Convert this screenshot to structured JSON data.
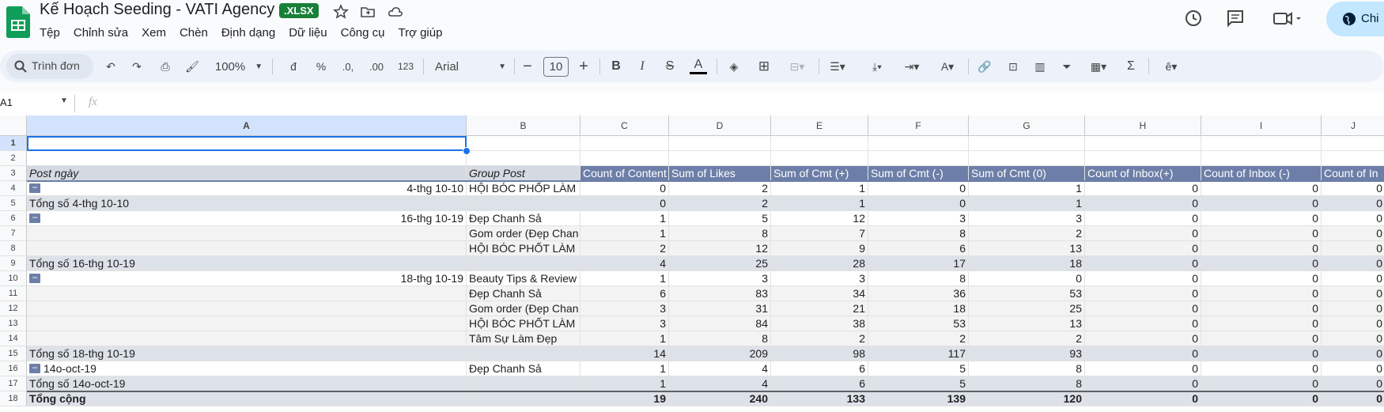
{
  "doc": {
    "title": "Kế Hoạch Seeding - VATI Agency",
    "badge": ".XLSX",
    "share_label": "Chi"
  },
  "menu": [
    "Tệp",
    "Chỉnh sửa",
    "Xem",
    "Chèn",
    "Định dạng",
    "Dữ liệu",
    "Công cụ",
    "Trợ giúp"
  ],
  "toolbar": {
    "search": "Trình đơn",
    "zoom": "100%",
    "currency": "đ",
    "percent": "%",
    "dec_decrease": ".0,",
    "dec_increase": ".00",
    "format_123": "123",
    "font": "Arial",
    "font_size": "10",
    "bold": "B",
    "italic": "I",
    "strike": "S",
    "textcolor": "A",
    "sigma": "Σ"
  },
  "formula_bar": {
    "cell_ref": "A1",
    "fx": "fx",
    "value": ""
  },
  "columns": [
    "A",
    "B",
    "C",
    "D",
    "E",
    "F",
    "G",
    "H",
    "I",
    "J"
  ],
  "header_row": {
    "a": "Post ngày",
    "b": "Group Post",
    "c": "Count of Content",
    "d": "Sum of Likes",
    "e": "Sum of Cmt (+)",
    "f": "Sum of Cmt (-)",
    "g": "Sum of Cmt (0)",
    "h": "Count of Inbox(+)",
    "i": "Count of Inbox (-)",
    "j": "Count of In"
  },
  "rows": [
    {
      "n": "1",
      "a": "",
      "b": "",
      "v": [
        "",
        "",
        "",
        "",
        "",
        "",
        "",
        ""
      ]
    },
    {
      "n": "2",
      "a": "",
      "b": "",
      "v": [
        "",
        "",
        "",
        "",
        "",
        "",
        "",
        ""
      ]
    },
    {
      "n": "4",
      "a": "4-thg 10-10",
      "b": "HỘI BÓC PHỐP LÀM",
      "v": [
        "0",
        "2",
        "1",
        "0",
        "1",
        "0",
        "0",
        "0"
      ]
    },
    {
      "n": "5",
      "a": "Tổng số 4-thg 10-10",
      "b": "",
      "v": [
        "0",
        "2",
        "1",
        "0",
        "1",
        "0",
        "0",
        "0"
      ]
    },
    {
      "n": "6",
      "a": "16-thg 10-19",
      "b": "Đẹp Chanh Sả",
      "v": [
        "1",
        "5",
        "12",
        "3",
        "3",
        "0",
        "0",
        "0"
      ]
    },
    {
      "n": "7",
      "a": "",
      "b": "Gom order (Đẹp Chan",
      "v": [
        "1",
        "8",
        "7",
        "8",
        "2",
        "0",
        "0",
        "0"
      ]
    },
    {
      "n": "8",
      "a": "",
      "b": "HỘI BÓC PHỐT LÀM",
      "v": [
        "2",
        "12",
        "9",
        "6",
        "13",
        "0",
        "0",
        "0"
      ]
    },
    {
      "n": "9",
      "a": "Tổng số 16-thg 10-19",
      "b": "",
      "v": [
        "4",
        "25",
        "28",
        "17",
        "18",
        "0",
        "0",
        "0"
      ]
    },
    {
      "n": "10",
      "a": "18-thg 10-19",
      "b": "Beauty Tips & Review",
      "v": [
        "1",
        "3",
        "3",
        "8",
        "0",
        "0",
        "0",
        "0"
      ]
    },
    {
      "n": "11",
      "a": "",
      "b": "Đẹp Chanh Sả",
      "v": [
        "6",
        "83",
        "34",
        "36",
        "53",
        "0",
        "0",
        "0"
      ]
    },
    {
      "n": "12",
      "a": "",
      "b": "Gom order (Đẹp Chan",
      "v": [
        "3",
        "31",
        "21",
        "18",
        "25",
        "0",
        "0",
        "0"
      ]
    },
    {
      "n": "13",
      "a": "",
      "b": "HỘI BÓC PHỐT LÀM",
      "v": [
        "3",
        "84",
        "38",
        "53",
        "13",
        "0",
        "0",
        "0"
      ]
    },
    {
      "n": "14",
      "a": "",
      "b": "Tâm Sự Làm Đẹp",
      "v": [
        "1",
        "8",
        "2",
        "2",
        "2",
        "0",
        "0",
        "0"
      ]
    },
    {
      "n": "15",
      "a": "Tổng số 18-thg 10-19",
      "b": "",
      "v": [
        "14",
        "209",
        "98",
        "117",
        "93",
        "0",
        "0",
        "0"
      ]
    },
    {
      "n": "16",
      "a": "14o-oct-19",
      "b": "Đẹp Chanh Sả",
      "v": [
        "1",
        "4",
        "6",
        "5",
        "8",
        "0",
        "0",
        "0"
      ]
    },
    {
      "n": "17",
      "a": "Tổng số 14o-oct-19",
      "b": "",
      "v": [
        "1",
        "4",
        "6",
        "5",
        "8",
        "0",
        "0",
        "0"
      ]
    },
    {
      "n": "18",
      "a": "Tổng cộng",
      "b": "",
      "v": [
        "19",
        "240",
        "133",
        "139",
        "120",
        "0",
        "0",
        "0"
      ]
    }
  ],
  "header_row_number": "3",
  "icons": [
    "sheets-logo",
    "star-icon",
    "move-folder-icon",
    "cloud-icon",
    "history-icon",
    "comment-icon",
    "meet-icon",
    "globe-icon",
    "search-icon",
    "undo-icon",
    "redo-icon",
    "print-icon",
    "paint-format-icon",
    "fill-color-icon",
    "borders-icon",
    "merge-icon",
    "align-icon",
    "valign-icon",
    "wrap-icon",
    "rotate-icon",
    "link-icon",
    "add-comment-icon",
    "chart-icon",
    "filter-icon",
    "filter-views-icon",
    "input-tools-icon"
  ],
  "colors": {
    "accent": "#6d7fa8",
    "badge": "#188038",
    "select": "#1a73e8"
  }
}
